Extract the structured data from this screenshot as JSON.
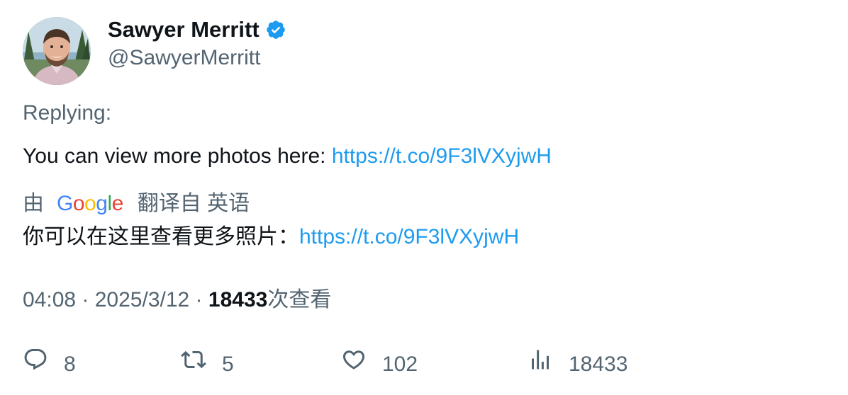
{
  "author": {
    "name": "Sawyer Merritt",
    "handle": "@SawyerMerritt",
    "verified": true,
    "badge_color": "#1d9bf0"
  },
  "tweet": {
    "replying_label": "Replying:",
    "text": "You can view more photos here: ",
    "link": "https://t.co/9F3lVXyjwH"
  },
  "translation": {
    "prefix": "由",
    "provider_logo": [
      "G",
      "o",
      "o",
      "g",
      "l",
      "e"
    ],
    "suffix": "翻译自 英语",
    "text": "你可以在这里查看更多照片：",
    "link": "https://t.co/9F3lVXyjwH"
  },
  "meta": {
    "time": "04:08",
    "separator": " · ",
    "date": "2025/3/12",
    "views_count": "18433",
    "views_label": "次查看"
  },
  "actions": {
    "replies": "8",
    "retweets": "5",
    "likes": "102",
    "views": "18433"
  },
  "icons": {
    "reply": "reply-bubble-icon",
    "retweet": "retweet-icon",
    "like": "heart-icon",
    "views": "analytics-bars-icon",
    "verified": "verified-badge-icon"
  }
}
